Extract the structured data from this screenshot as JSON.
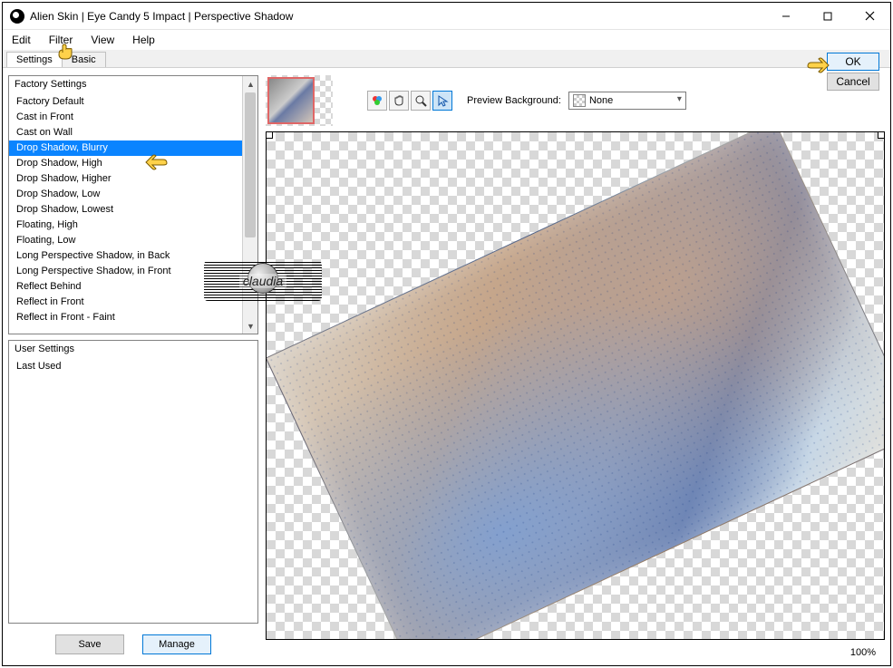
{
  "title": "Alien Skin | Eye Candy 5 Impact | Perspective Shadow",
  "menu": {
    "edit": "Edit",
    "filter": "Filter",
    "view": "View",
    "help": "Help"
  },
  "tabs": {
    "settings": "Settings",
    "basic": "Basic"
  },
  "factory": {
    "header": "Factory Settings",
    "items": [
      "Factory Default",
      "Cast in Front",
      "Cast on Wall",
      "Drop Shadow, Blurry",
      "Drop Shadow, High",
      "Drop Shadow, Higher",
      "Drop Shadow, Low",
      "Drop Shadow, Lowest",
      "Floating, High",
      "Floating, Low",
      "Long Perspective Shadow, in Back",
      "Long Perspective Shadow, in Front",
      "Reflect Behind",
      "Reflect in Front",
      "Reflect in Front - Faint"
    ],
    "selected_index": 3
  },
  "user": {
    "header": "User Settings",
    "items": [
      "Last Used"
    ]
  },
  "buttons": {
    "save": "Save",
    "manage": "Manage",
    "ok": "OK",
    "cancel": "Cancel"
  },
  "preview_background": {
    "label": "Preview Background:",
    "value": "None"
  },
  "zoom": "100%",
  "watermark": "claudia"
}
